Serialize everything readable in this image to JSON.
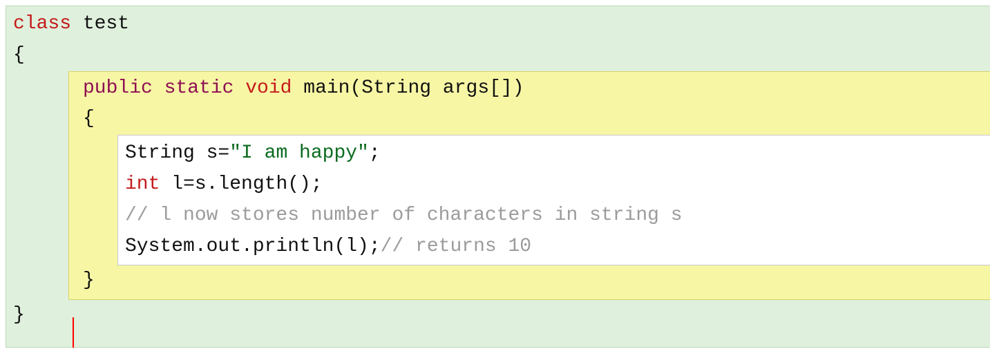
{
  "code": {
    "outer": {
      "class_kw": "class",
      "class_name": " test",
      "open_brace": "{",
      "close_brace": "}"
    },
    "method": {
      "modifiers": "public static ",
      "ret_type": "void",
      "sig_rest": " main(String args[])",
      "open_brace": "{",
      "close_brace": "}"
    },
    "body": {
      "line1_a": "String s=",
      "line1_str": "\"I am happy\"",
      "line1_b": ";",
      "line2_kw": "int",
      "line2_rest": " l=s.length();",
      "line3_comment": "// l now stores number of characters in string s",
      "line4_code": "System.out.println(l);",
      "line4_comment": "// returns 10"
    }
  },
  "chart_data": {
    "type": "code-snippet",
    "language": "Java",
    "raw": "class test\n{\n    public static void main(String args[])\n    {\n        String s=\"I am happy\";\n        int l=s.length();\n        // l now stores number of characters in string s\n        System.out.println(l);// returns 10\n    }\n}"
  }
}
